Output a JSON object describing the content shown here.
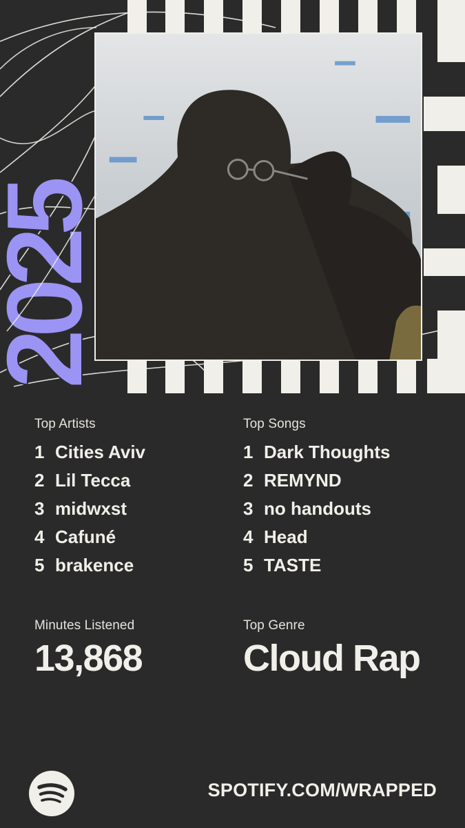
{
  "year": "2025",
  "top_artists": {
    "label": "Top Artists",
    "items": [
      {
        "rank": "1",
        "name": "Cities Aviv"
      },
      {
        "rank": "2",
        "name": "Lil Tecca"
      },
      {
        "rank": "3",
        "name": "midwxst"
      },
      {
        "rank": "4",
        "name": "Cafuné"
      },
      {
        "rank": "5",
        "name": "brakence"
      }
    ]
  },
  "top_songs": {
    "label": "Top Songs",
    "items": [
      {
        "rank": "1",
        "name": "Dark Thoughts"
      },
      {
        "rank": "2",
        "name": "REMYND"
      },
      {
        "rank": "3",
        "name": "no handouts"
      },
      {
        "rank": "4",
        "name": "Head"
      },
      {
        "rank": "5",
        "name": "TASTE"
      }
    ]
  },
  "minutes": {
    "label": "Minutes Listened",
    "value": "13,868"
  },
  "genre": {
    "label": "Top Genre",
    "value": "Cloud Rap"
  },
  "footer": {
    "url": "SPOTIFY.COM/WRAPPED",
    "logo_icon": "spotify-logo-icon"
  },
  "colors": {
    "background": "#2a2a2a",
    "text": "#f1efe9",
    "accent": "#9b94f5"
  }
}
